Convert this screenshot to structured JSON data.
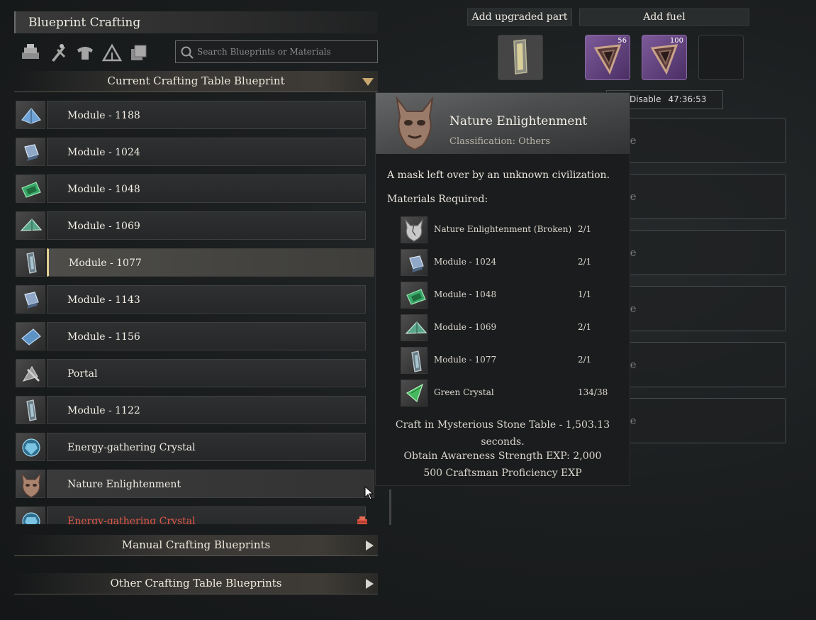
{
  "panel": {
    "title": "Blueprint Crafting",
    "category_icons": [
      "materials-icon",
      "weapons-icon",
      "armor-icon",
      "camp-icon",
      "building-icon"
    ],
    "search_placeholder": "Search Blueprints or Materials"
  },
  "sections": {
    "current": "Current Crafting Table Blueprint",
    "manual": "Manual Crafting Blueprints",
    "other": "Other Crafting Table Blueprints"
  },
  "blueprints": [
    {
      "label": "Module - 1188",
      "icon": "blue-pyramid-module-icon",
      "state": ""
    },
    {
      "label": "Module - 1024",
      "icon": "blue-cube-module-icon",
      "state": ""
    },
    {
      "label": "Module - 1048",
      "icon": "green-plate-module-icon",
      "state": ""
    },
    {
      "label": "Module - 1069",
      "icon": "green-prism-module-icon",
      "state": ""
    },
    {
      "label": "Module - 1077",
      "icon": "rod-module-icon",
      "state": "selected"
    },
    {
      "label": "Module - 1143",
      "icon": "blue-cube-module-icon",
      "state": ""
    },
    {
      "label": "Module - 1156",
      "icon": "blue-plate-module-icon",
      "state": ""
    },
    {
      "label": "Portal",
      "icon": "portal-icon",
      "state": ""
    },
    {
      "label": "Module - 1122",
      "icon": "rod-module-icon",
      "state": ""
    },
    {
      "label": "Energy-gathering Crystal",
      "icon": "energy-crystal-icon",
      "state": ""
    },
    {
      "label": "Nature Enlightenment",
      "icon": "mask-icon",
      "state": "hover"
    },
    {
      "label": "Energy-gathering Crystal",
      "icon": "energy-crystal-icon",
      "state": "unavailable"
    }
  ],
  "crafting": {
    "add_part": "Add upgraded part",
    "add_fuel": "Add fuel",
    "fuel_slots": [
      {
        "count": "56",
        "icon": "fuel-core-icon"
      },
      {
        "count": "100",
        "icon": "fuel-core-icon"
      }
    ],
    "disable_label": "Disable",
    "timer": "47:36:53",
    "queue_label": "ue"
  },
  "tooltip": {
    "name": "Nature Enlightenment",
    "classification": "Classification: Others",
    "description": "A mask left over by an unknown civilization.",
    "materials_label": "Materials Required:",
    "materials": [
      {
        "name": "Nature Enlightenment (Broken)",
        "qty": "2/1",
        "icon": "broken-mask-icon"
      },
      {
        "name": "Module - 1024",
        "qty": "2/1",
        "icon": "blue-cube-module-icon"
      },
      {
        "name": "Module - 1048",
        "qty": "1/1",
        "icon": "green-plate-module-icon"
      },
      {
        "name": "Module - 1069",
        "qty": "2/1",
        "icon": "green-prism-module-icon"
      },
      {
        "name": "Module - 1077",
        "qty": "2/1",
        "icon": "rod-module-icon"
      },
      {
        "name": "Green Crystal",
        "qty": "134/38",
        "icon": "green-crystal-icon"
      }
    ],
    "craft_info": "Craft in Mysterious Stone Table - 1,503.13 seconds.",
    "exp1": "Obtain Awareness Strength EXP: 2,000",
    "exp2": "500 Craftsman Proficiency EXP"
  }
}
